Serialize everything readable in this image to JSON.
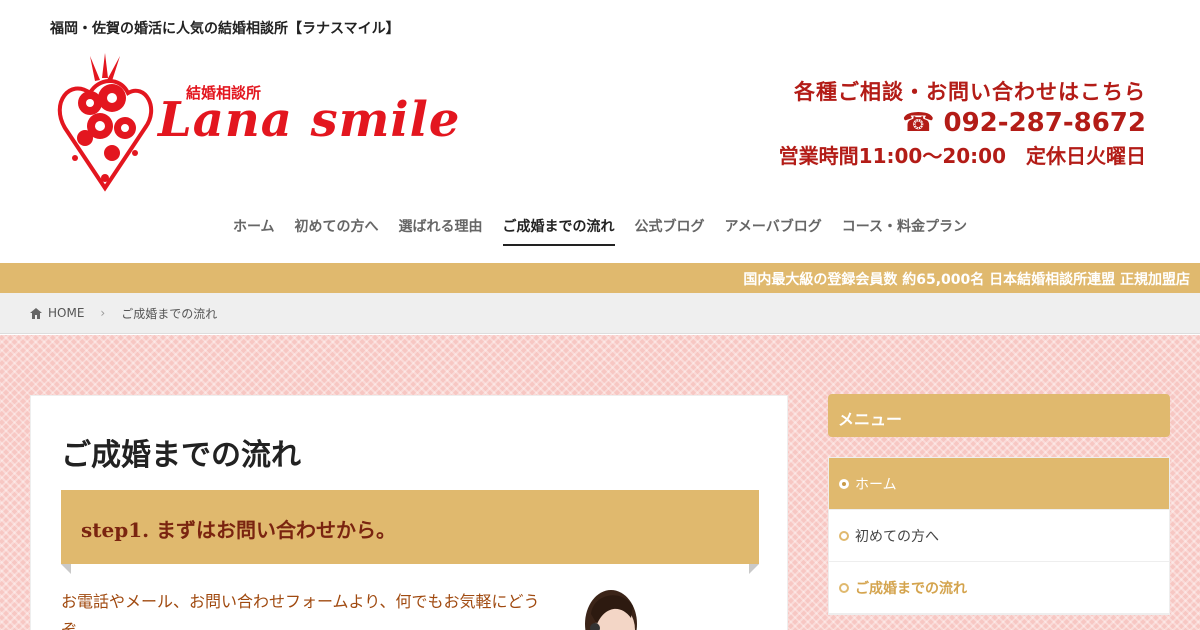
{
  "header": {
    "tagline": "福岡・佐賀の婚活に人気の結婚相談所【ラナスマイル】",
    "logo_sub": "結婚相談所",
    "logo_main": "Lana smile",
    "contact_line1": "各種ご相談・お問い合わせはこちら",
    "contact_phone": "☎ 092-287-8672",
    "contact_hours": "営業時間11:00〜20:00　定休日火曜日"
  },
  "nav": {
    "items": [
      {
        "label": "ホーム"
      },
      {
        "label": "初めての方へ"
      },
      {
        "label": "選ばれる理由"
      },
      {
        "label": "ご成婚までの流れ"
      },
      {
        "label": "公式ブログ"
      },
      {
        "label": "アメーバブログ"
      },
      {
        "label": "コース・料金プラン"
      }
    ],
    "active_index": 3
  },
  "ribbon": "国内最大級の登録会員数 約65,000名 日本結婚相談所連盟 正規加盟店",
  "breadcrumb": {
    "home": "HOME",
    "current": "ご成婚までの流れ"
  },
  "main": {
    "title": "ご成婚までの流れ",
    "step1_heading": "step1. まずはお問い合わせから。",
    "step1_body": "お電話やメール、お問い合わせフォームより、何でもお気軽にどうぞ。"
  },
  "sidebar": {
    "heading": "メニュー",
    "items": [
      {
        "label": "ホーム"
      },
      {
        "label": "初めての方へ"
      },
      {
        "label": "ご成婚までの流れ"
      }
    ]
  },
  "colors": {
    "accent": "#e0b96e",
    "brand_red": "#e3161f",
    "heading_brown": "#7a2410"
  }
}
